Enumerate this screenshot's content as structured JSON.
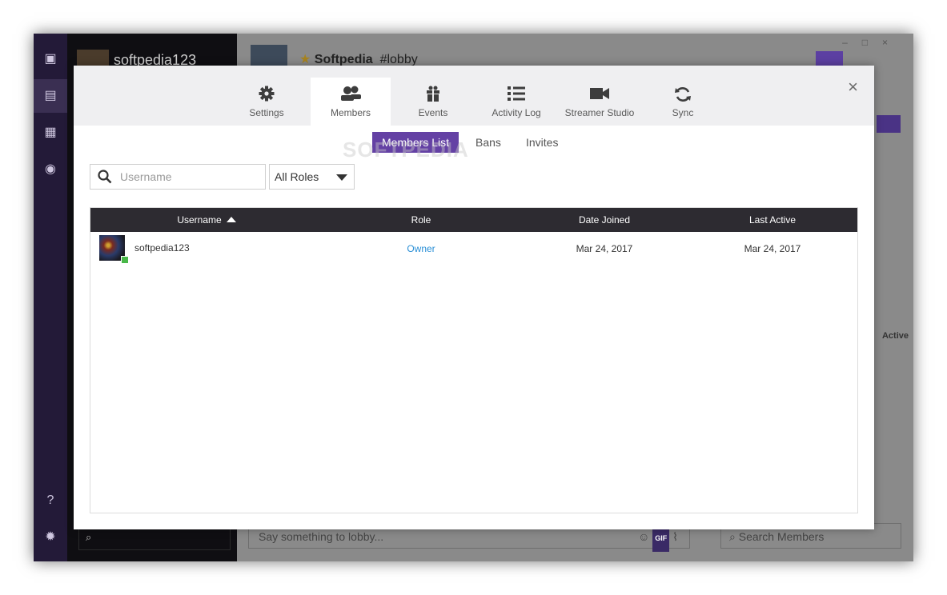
{
  "background": {
    "channel_user": "softpedia123",
    "server_name": "Softpedia",
    "channel": "#lobby",
    "message_placeholder": "Say something to lobby...",
    "gif_label": "GIF",
    "members_search_placeholder": "Search Members",
    "side_label": "Active"
  },
  "modal": {
    "tabs": [
      {
        "label": "Settings",
        "icon": "gear-icon"
      },
      {
        "label": "Members",
        "icon": "members-icon"
      },
      {
        "label": "Events",
        "icon": "gift-icon"
      },
      {
        "label": "Activity Log",
        "icon": "list-icon"
      },
      {
        "label": "Streamer Studio",
        "icon": "video-camera-icon"
      },
      {
        "label": "Sync",
        "icon": "sync-icon"
      }
    ],
    "active_tab": "Members",
    "close_label": "×",
    "subtabs": [
      "Members List",
      "Bans",
      "Invites"
    ],
    "active_subtab": "Members List",
    "search_placeholder": "Username",
    "role_filter": "All Roles",
    "columns": [
      "Username",
      "Role",
      "Date Joined",
      "Last Active"
    ],
    "sort_column": "Username",
    "sort_direction": "ascending",
    "rows": [
      {
        "username": "softpedia123",
        "role": "Owner",
        "date_joined": "Mar 24, 2017",
        "last_active": "Mar 24, 2017",
        "online": true
      }
    ]
  },
  "watermark": "SOFTPEDIA",
  "colors": {
    "accent": "#6441a4",
    "header": "#2d2b31",
    "role_link": "#2a8fd6",
    "online": "#49b849"
  }
}
